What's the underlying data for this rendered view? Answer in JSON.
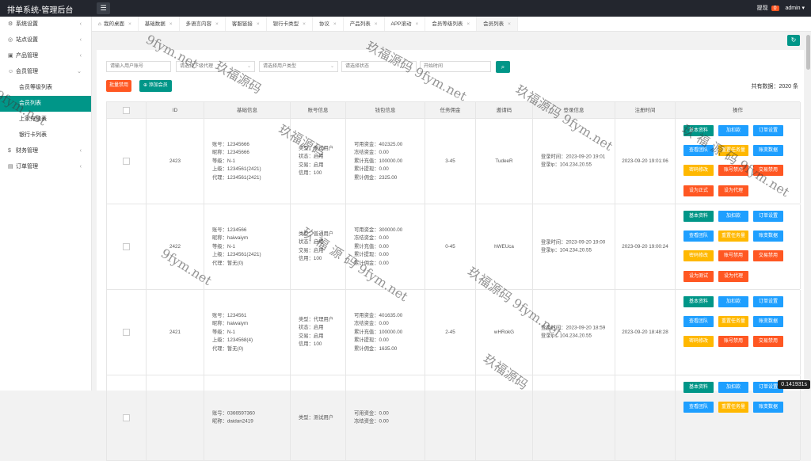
{
  "app": {
    "title": "排单系统-管理后台",
    "notice_label": "提现",
    "notice_count": "0",
    "user": "admin",
    "user_caret": "▾"
  },
  "sidebar": {
    "items": [
      {
        "label": "系统设置",
        "icon": "gear-icon",
        "glyph": "⚙",
        "chev": "‹"
      },
      {
        "label": "站点设置",
        "icon": "globe-icon",
        "glyph": "◎",
        "chev": "‹"
      },
      {
        "label": "产品管理",
        "icon": "box-icon",
        "glyph": "▣",
        "chev": "‹"
      },
      {
        "label": "会员管理",
        "icon": "user-icon",
        "glyph": "☺",
        "chev": "⌄"
      }
    ],
    "subs": [
      {
        "label": "会员等级列表"
      },
      {
        "label": "会员列表",
        "active": true
      },
      {
        "label": "上家充值表"
      },
      {
        "label": "银行卡列表"
      }
    ],
    "bottom": [
      {
        "label": "财务管理",
        "icon": "finance-icon",
        "glyph": "$",
        "chev": "‹"
      },
      {
        "label": "订单管理",
        "icon": "order-icon",
        "glyph": "▤",
        "chev": "‹"
      }
    ]
  },
  "tabs": [
    {
      "label": "我的桌面",
      "home": true
    },
    {
      "label": "基础数据"
    },
    {
      "label": "多语言内容"
    },
    {
      "label": "客服链接"
    },
    {
      "label": "银行卡类型"
    },
    {
      "label": "协议"
    },
    {
      "label": "产品列表"
    },
    {
      "label": "APP滚动"
    },
    {
      "label": "会员等级列表"
    },
    {
      "label": "会员列表",
      "active": true
    }
  ],
  "filters": {
    "account_placeholder": "请输入用户账号",
    "agent_placeholder": "请选择下级代理",
    "user_type_placeholder": "请选择用户类型",
    "status_placeholder": "请选择状态",
    "time_placeholder": "开始时间"
  },
  "actions": {
    "ban": "批量禁用",
    "add": "添加会员",
    "add_icon": "⊕"
  },
  "total": "共有数据：2020 条",
  "columns": [
    "ID",
    "基础信息",
    "账号信息",
    "钱包信息",
    "任务佣金",
    "邀请码",
    "登录信息",
    "注册时间",
    "操作"
  ],
  "rows": [
    {
      "id": "2423",
      "basic": [
        "账号：12345666",
        "昵称：12345666",
        "等级：N-1",
        "上级：1234561(2421)",
        "代理：1234561(2421)"
      ],
      "account": [
        "类型：测试用户",
        "状态：启用",
        "交易：启用",
        "信用：100"
      ],
      "wallet": [
        "可用资金：402325.00",
        "冻结资金：0.00",
        "累计充值：100000.00",
        "累计提现：0.00",
        "累计佣金：2325.00"
      ],
      "task": "3-45",
      "invite": "TudeeR",
      "login": [
        "登录时间：2023-09-20 19:01",
        "登录ip：104.234.20.55"
      ],
      "register": "2023-09-20 19:01:06",
      "ops": [
        "基本资料",
        "加扣款",
        "订单设置",
        "查看团队",
        "重置任务量",
        "账变数据",
        "密码修改",
        "账号禁用",
        "交易禁用",
        "设为正式",
        "设为代理"
      ]
    },
    {
      "id": "2422",
      "basic": [
        "账号：1234566",
        "昵称：haiwaiym",
        "等级：N-1",
        "上级：1234561(2421)",
        "代理：暂无(0)"
      ],
      "account": [
        "类型：普通用户",
        "状态：启用",
        "交易：启用",
        "信用：100"
      ],
      "wallet": [
        "可用资金：300000.00",
        "冻结资金：0.00",
        "累计充值：0.00",
        "累计提现：0.00",
        "累计佣金：0.00"
      ],
      "task": "0-45",
      "invite": "hWEUca",
      "login": [
        "登录时间：2023-09-20 19:00",
        "登录ip：104.234.20.55"
      ],
      "register": "2023-09-20 19:00:24",
      "ops": [
        "基本资料",
        "加扣款",
        "订单设置",
        "查看团队",
        "重置任务量",
        "账变数据",
        "密码修改",
        "账号禁用",
        "交易禁用",
        "设为测试",
        "设为代理"
      ]
    },
    {
      "id": "2421",
      "basic": [
        "账号：1234561",
        "昵称：haiwaiym",
        "等级：N-1",
        "上级：1234568(4)",
        "代理：暂无(0)"
      ],
      "account": [
        "类型：代理用户",
        "状态：启用",
        "交易：启用",
        "信用：100"
      ],
      "wallet": [
        "可用资金：401635.00",
        "冻结资金：0.00",
        "累计充值：100000.00",
        "累计提现：0.00",
        "累计佣金：1635.00"
      ],
      "task": "2-45",
      "invite": "wHRokG",
      "login": [
        "登录时间：2023-09-20 18:59",
        "登录ip：104.234.20.55"
      ],
      "register": "2023-09-20 18:48:28",
      "ops": [
        "基本资料",
        "加扣款",
        "订单设置",
        "查看团队",
        "重置任务量",
        "账变数据",
        "密码修改",
        "账号禁用",
        "交易禁用"
      ]
    },
    {
      "id": "",
      "basic": [
        "账号：0366597360",
        "昵称：daidan2419"
      ],
      "account": [
        "类型：测试用户"
      ],
      "wallet": [
        "可用资金：0.00",
        "冻结资金：0.00"
      ],
      "task": "",
      "invite": "",
      "login": [],
      "register": "",
      "ops": [
        "基本资料",
        "加扣款",
        "订单设置",
        "查看团队",
        "重置任务量",
        "账变数据"
      ]
    }
  ],
  "watermarks": [
    "9fym.net",
    "玖福源码 9fym.net",
    "玖福源码",
    "9fym.net",
    "玖福源码 9fym.net",
    "玖福源码",
    "9fym.net",
    "玖福源码 9fym.net",
    "玖 福 源 码 9fym.net",
    "玖 福 源 码 9fym.net",
    "玖福源码"
  ],
  "timer": "0.141931s",
  "colors": {
    "teal": "#009688",
    "orange": "#ff5722",
    "blue": "#1e9fff",
    "yellow": "#ffb800",
    "dark": "#23262e"
  },
  "icons": {
    "menu": "☰",
    "refresh": "↻",
    "search": "⌕",
    "home": "⌂",
    "close": "×",
    "select_arrow": "⌄"
  }
}
